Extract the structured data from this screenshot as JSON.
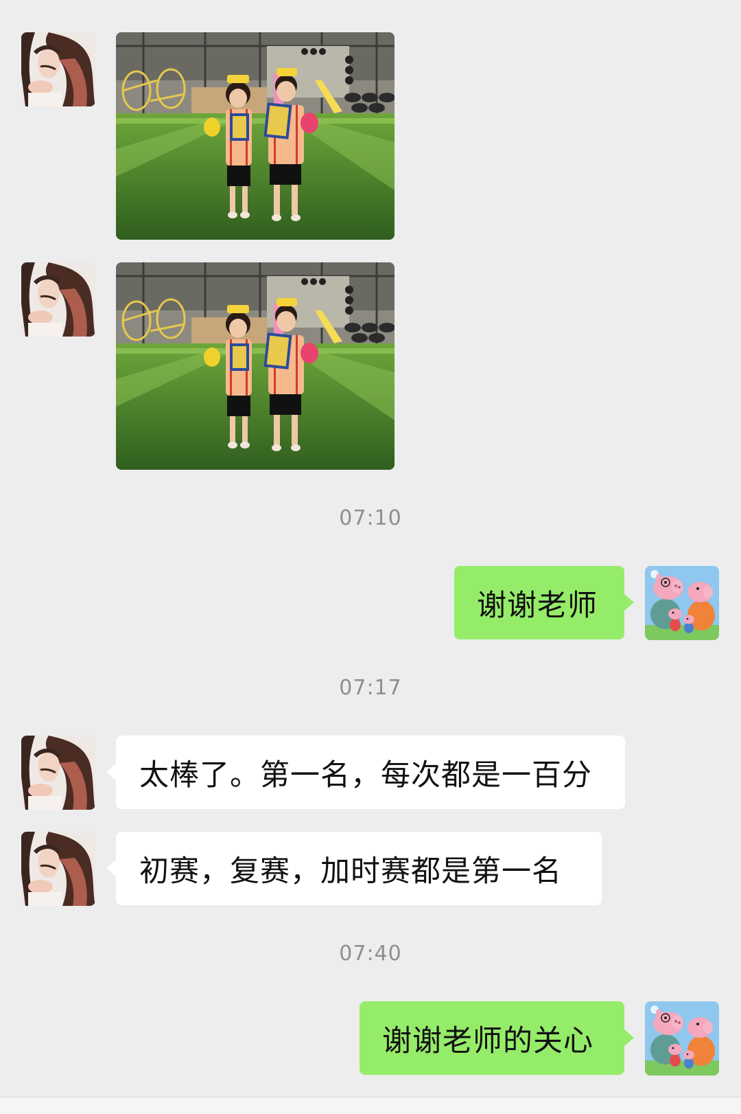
{
  "chat": {
    "timestamps": [
      "07:10",
      "07:17",
      "07:40"
    ],
    "messages": {
      "sent_1": "谢谢老师",
      "received_1": "太棒了。第一名，每次都是一百分",
      "received_2": "初赛，复赛，加时赛都是第一名",
      "sent_2": "谢谢老师的关心"
    }
  },
  "colors": {
    "background": "#ededed",
    "sent_bubble": "#95ec69",
    "received_bubble": "#ffffff",
    "timestamp_text": "#8e8e8e"
  },
  "icons": {
    "contact_avatar": "woman-portrait-avatar",
    "self_avatar": "cartoon-pig-family-avatar"
  }
}
